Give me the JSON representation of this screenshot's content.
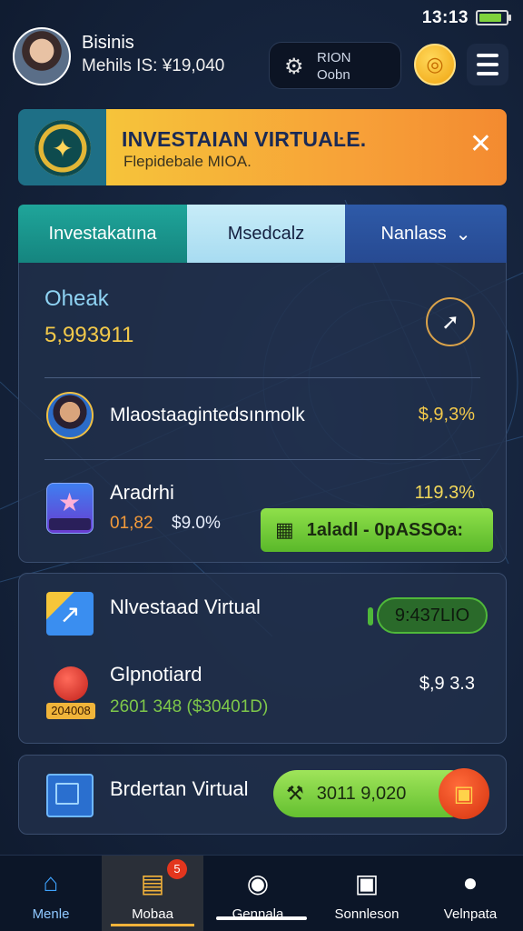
{
  "status_bar": {
    "time": "13:13",
    "icons": [
      "nfc-icon",
      "wifi-icon",
      "signal-icon",
      "battery-icon"
    ]
  },
  "header": {
    "user_name": "Bisinis",
    "user_balance": "Mehils IS: ¥19,040",
    "rion_title": "RION",
    "rion_sub": "Oobn",
    "coin_icon": "coin-icon",
    "menu_icon": "menu-icon"
  },
  "banner": {
    "title": "INVESTAIAN VIRTUAĿE.",
    "subtitle": "Flepidebale MIOA.",
    "close_label": "✕"
  },
  "tabs": [
    {
      "label": "Investakatına"
    },
    {
      "label": "Msedcalz"
    },
    {
      "label": "Nanlass"
    }
  ],
  "main": {
    "label": "Oheak",
    "value": "5,993911",
    "row1": {
      "name": "Mlaostaagintedsınmolk",
      "pct": "$,9,3%"
    },
    "row2": {
      "name": "Aradrhi",
      "pct": "119.3%",
      "meta_a": "01,82",
      "meta_b": "$9.0%",
      "button_label": "1aladl - 0pASSOa:"
    }
  },
  "card2": {
    "title": "Nlvestaad Virtual",
    "pill": "9:437LIO",
    "name": "Glpnotiard",
    "sub": "2601 348 ($30401D)",
    "amount": "$,9 3.3",
    "icon_label": "204008"
  },
  "card3": {
    "title": "Brdertan Virtual",
    "button_label": "3011 9,020"
  },
  "bottom_nav": [
    {
      "label": "Menle",
      "icon": "home-icon"
    },
    {
      "label": "Mobaa",
      "icon": "wallet-icon",
      "badge": "5"
    },
    {
      "label": "Gennala",
      "icon": "profile-circle-icon"
    },
    {
      "label": "Sonnleson",
      "icon": "contact-card-icon"
    },
    {
      "label": "Velnpata",
      "icon": "user-icon"
    }
  ],
  "colors": {
    "accent_gold": "#f3c94a",
    "accent_green": "#6ec83a",
    "background": "#172640",
    "banner_orange": "#f7a038"
  }
}
